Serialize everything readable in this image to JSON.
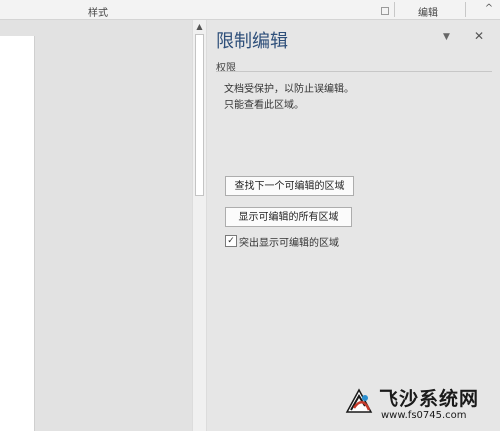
{
  "ribbon": {
    "styles_label": "样式",
    "editing_label": "编辑",
    "collapse_icon": "chevron-up-icon"
  },
  "pane": {
    "title": "限制编辑",
    "menu_icon": "▼",
    "close_icon": "✕",
    "section_header": "权限",
    "desc_line1": "文档受保护，以防止误编辑。",
    "desc_line2": "只能查看此区域。",
    "find_next_button": "查找下一个可编辑的区域",
    "show_all_button": "显示可编辑的所有区域",
    "highlight_checkbox_label": "突出显示可编辑的区域",
    "highlight_checked": true
  },
  "watermark": {
    "title": "飞沙系统网",
    "url": "www.fs0745.com"
  },
  "colors": {
    "title_blue": "#2e4f7a",
    "pane_bg": "#e6e6e6"
  }
}
